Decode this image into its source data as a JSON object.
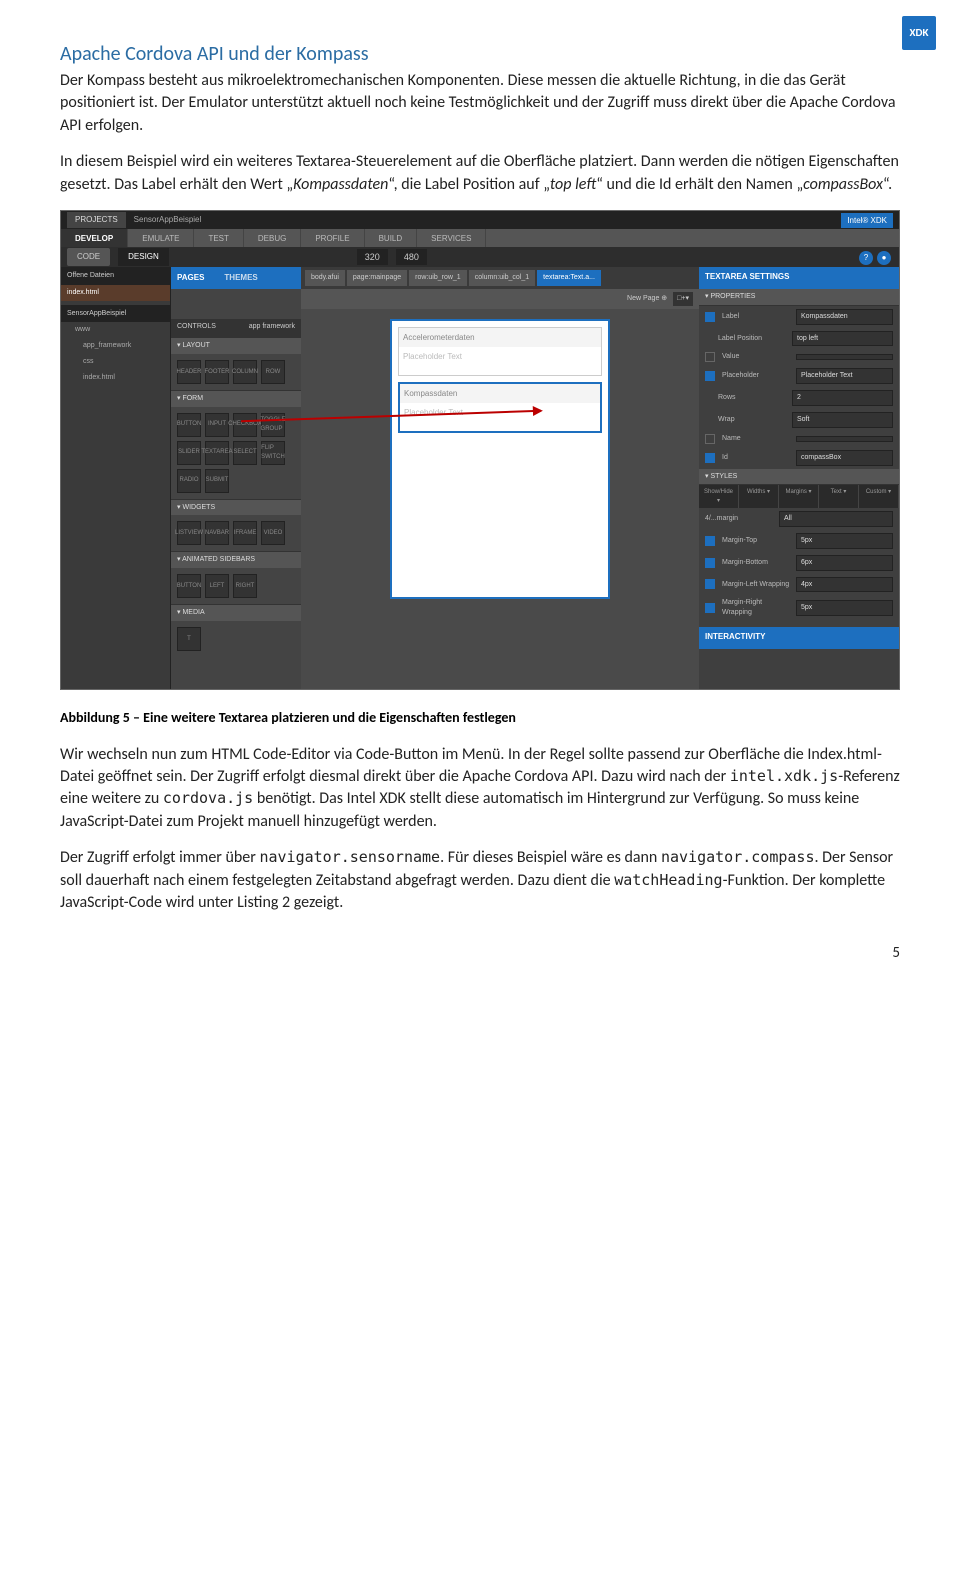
{
  "logo": "XDK",
  "title": "Apache Cordova API und der Kompass",
  "p1": "Der Kompass besteht aus mikroelektromechanischen Komponenten. Diese messen die aktuelle Richtung, in die das Gerät positioniert ist. Der Emulator unterstützt aktuell noch keine Testmöglichkeit und der Zugriff muss direkt über die Apache Cordova API erfolgen.",
  "p2a": "In diesem Beispiel wird ein weiteres Textarea-Steuerelement auf die Oberfläche platziert. Dann werden die nötigen Eigenschaften gesetzt. Das Label erhält den Wert „",
  "p2i1": "Kompassdaten",
  "p2b": "“, die Label Position auf „",
  "p2i2": "top left",
  "p2c": "“ und die Id erhält den Namen „",
  "p2i3": "compassBox",
  "p2d": "“.",
  "caption": "Abbildung 5 – Eine weitere Textarea platzieren und die Eigenschaften festlegen",
  "p3a": "Wir wechseln nun zum HTML Code-Editor via Code-Button im Menü. In der Regel sollte passend zur Oberfläche die Index.html-Datei geöffnet sein. Der Zugriff erfolgt diesmal direkt über die Apache Cordova API. Dazu wird nach der ",
  "p3m1": "intel.xdk.js",
  "p3b": "-Referenz eine weitere zu ",
  "p3m2": "cordova.js",
  "p3c": " benötigt. Das Intel XDK stellt diese automatisch im Hintergrund zur Verfügung. So muss keine JavaScript-Datei zum Projekt manuell hinzugefügt werden.",
  "p4a": "Der Zugriff erfolgt immer über ",
  "p4m1": "navigator.sensorname",
  "p4b": ". Für dieses Beispiel wäre es dann ",
  "p4m2": "navigator.compass",
  "p4c": ". Der Sensor soll dauerhaft nach einem festgelegten Zeitabstand abgefragt werden. Dazu dient die ",
  "p4m3": "watchHeading",
  "p4d": "-Funktion. Der komplette JavaScript-Code wird unter Listing 2 gezeigt.",
  "pagenum": "5",
  "shot": {
    "projects": "PROJECTS",
    "apptitle": "SensorAppBeispiel",
    "brand": "Intel® XDK",
    "maintabs": [
      "DEVELOP",
      "EMULATE",
      "TEST",
      "DEBUG",
      "PROFILE",
      "BUILD",
      "SERVICES"
    ],
    "code": "CODE",
    "design": "DESIGN",
    "size1": "320",
    "size2": "480",
    "files_hd": "Offene Dateien",
    "file1": "index.html",
    "file2": "SensorAppBeispiel",
    "tree": [
      "www",
      "app_framework",
      "css",
      "index.html"
    ],
    "pages": "PAGES",
    "themes": "THEMES",
    "controls": "CONTROLS",
    "appfw": "app framework",
    "sec_layout": "▾ LAYOUT",
    "layout_items": [
      "HEADER",
      "FOOTER",
      "COLUMN",
      "ROW"
    ],
    "sec_form": "▾ FORM",
    "form_items": [
      "BUTTON",
      "INPUT",
      "CHECKBOX",
      "TOGGLE GROUP",
      "SLIDER",
      "TEXTAREA",
      "SELECT",
      "FLIP SWITCH",
      "RADIO",
      "SUBMIT"
    ],
    "sec_widgets": "▾ WIDGETS",
    "widget_items": [
      "LISTVIEW",
      "NAVBAR",
      "IFRAME",
      "VIDEO"
    ],
    "sec_anim": "▾ ANIMATED SIDEBARS",
    "anim_items": [
      "BUTTON",
      "LEFT",
      "RIGHT"
    ],
    "sec_media": "▾ MEDIA",
    "newpage": "New Page ⊕",
    "bc": [
      "body.afui",
      "page:mainpage",
      "row:uib_row_1",
      "column:uib_col_1",
      "textarea:Text.a..."
    ],
    "device_ta1_hdr": "Accelerometerdaten",
    "device_ta_ph": "Placeholder Text",
    "device_ta2_hdr": "Kompassdaten",
    "settings": "TEXTAREA SETTINGS",
    "sec_prop": "▾ PROPERTIES",
    "prop_label": "Label",
    "prop_label_v": "Kompassdaten",
    "prop_lp": "Label Position",
    "prop_lp_v": "top left",
    "prop_value": "Value",
    "prop_value_v": "",
    "prop_ph": "Placeholder",
    "prop_ph_v": "Placeholder Text",
    "prop_rows": "Rows",
    "prop_rows_v": "2",
    "prop_wrap": "Wrap",
    "prop_wrap_v": "Soft",
    "prop_name": "Name",
    "prop_name_v": "",
    "prop_id": "Id",
    "prop_id_v": "compassBox",
    "sec_styles": "▾ STYLES",
    "style_tabs": [
      "Show/Hide ▾",
      "Widths ▾",
      "Margins ▾",
      "Text ▾",
      "Custom ▾"
    ],
    "style_chip": "4/...margin",
    "style_all": "All",
    "m_top": "Margin-Top",
    "m_top_v": "5px",
    "m_bot": "Margin-Bottom",
    "m_bot_v": "6px",
    "m_lw": "Margin-Left Wrapping",
    "m_lw_v": "4px",
    "m_rw": "Margin-Right Wrapping",
    "m_rw_v": "5px",
    "interactivity": "INTERACTIVITY"
  }
}
